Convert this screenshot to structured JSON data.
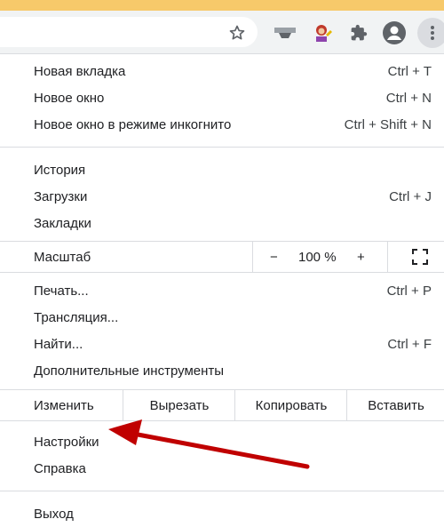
{
  "colors": {
    "accent_strip": "#f7c96a",
    "arrow": "#c00000"
  },
  "toolbar": {
    "icons": [
      "star-icon",
      "extension-1-icon",
      "extension-2-icon",
      "puzzle-icon",
      "avatar-icon",
      "kebab-menu-icon"
    ]
  },
  "menu": {
    "group1": [
      {
        "label": "Новая вкладка",
        "shortcut": "Ctrl + T"
      },
      {
        "label": "Новое окно",
        "shortcut": "Ctrl + N"
      },
      {
        "label": "Новое окно в режиме инкогнито",
        "shortcut": "Ctrl + Shift + N"
      }
    ],
    "group2": [
      {
        "label": "История",
        "shortcut": ""
      },
      {
        "label": "Загрузки",
        "shortcut": "Ctrl + J"
      },
      {
        "label": "Закладки",
        "shortcut": ""
      }
    ],
    "zoom": {
      "label": "Масштаб",
      "minus": "−",
      "value": "100 %",
      "plus": "+"
    },
    "group3": [
      {
        "label": "Печать...",
        "shortcut": "Ctrl + P"
      },
      {
        "label": "Трансляция...",
        "shortcut": ""
      },
      {
        "label": "Найти...",
        "shortcut": "Ctrl + F"
      },
      {
        "label": "Дополнительные инструменты",
        "shortcut": ""
      }
    ],
    "edit": {
      "label": "Изменить",
      "cut": "Вырезать",
      "copy": "Копировать",
      "paste": "Вставить"
    },
    "group4": [
      {
        "label": "Настройки"
      },
      {
        "label": "Справка"
      }
    ],
    "exit": {
      "label": "Выход"
    }
  }
}
